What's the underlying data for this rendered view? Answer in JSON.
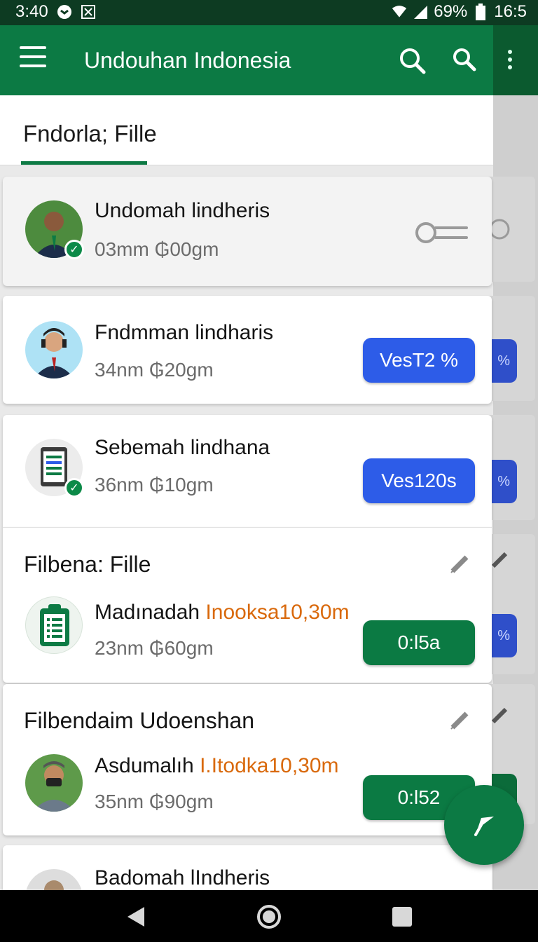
{
  "status_bar": {
    "time": "3:40",
    "battery": "69%",
    "clock_right": "16:5"
  },
  "app_bar": {
    "title": "Undouhan Indonesia",
    "icons": [
      "menu-icon",
      "search-icon",
      "search-icon",
      "more-vert-icon"
    ],
    "accent": "#0c7a44"
  },
  "tab": {
    "label": "Fndorla; Fille"
  },
  "items": [
    {
      "title": "Undomah lindheris",
      "subtitle": "03mm ₲00gm",
      "avatar": "person-avatar",
      "verified": true,
      "action": "toggle"
    },
    {
      "title": "Fndmman lindharis",
      "subtitle": "34nm ₲20gm",
      "avatar": "person-avatar",
      "verified": false,
      "action_label": "VesT2 %"
    },
    {
      "title": "Sebemah lindhana",
      "subtitle": "36nm ₲10gm",
      "avatar": "document-icon",
      "verified": true,
      "action_label": "Ves120s"
    }
  ],
  "sections": [
    {
      "title": "Filbena: Fille",
      "item": {
        "title": "Madınadah",
        "highlight": "Inooksa10,30m",
        "subtitle": "23nm ₲60gm",
        "avatar": "clipboard-icon",
        "action_label": "0:l5a"
      }
    },
    {
      "title": "Filbendaim Udoenshan",
      "item": {
        "title": "Asdumalıh",
        "highlight": "I.Itodka10,30m",
        "subtitle": "35nm ₲90gm",
        "avatar": "person-avatar",
        "action_label": "0:l52"
      }
    }
  ],
  "last_item": {
    "title": "Badomah lIndheris"
  },
  "colors": {
    "primary": "#0c7a44",
    "blue_pill": "#2d5ce8",
    "highlight": "#d9690c"
  }
}
